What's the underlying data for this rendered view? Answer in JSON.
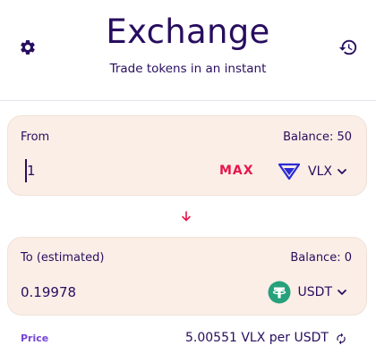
{
  "header": {
    "title": "Exchange",
    "subtitle": "Trade tokens in an instant",
    "settings_icon": "gear-icon",
    "history_icon": "history-icon"
  },
  "from": {
    "label": "From",
    "balance": "Balance: 50",
    "amount": "1",
    "max_label": "MAX",
    "token": {
      "symbol": "VLX",
      "icon": "velas-logo-icon",
      "color": "#2b2bd6"
    }
  },
  "swap": {
    "icon": "arrow-down-icon",
    "color": "#e8164b"
  },
  "to": {
    "label": "To (estimated)",
    "balance": "Balance: 0",
    "amount": "0.19978",
    "token": {
      "symbol": "USDT",
      "icon": "tether-logo-icon",
      "color": "#26a17b"
    }
  },
  "price": {
    "label": "Price",
    "value": "5.00551 VLX per USDT",
    "refresh_icon": "refresh-icon"
  },
  "colors": {
    "text": "#280d5f",
    "panel": "#faeee6",
    "accent": "#e8164b",
    "price_label": "#7645d9"
  }
}
